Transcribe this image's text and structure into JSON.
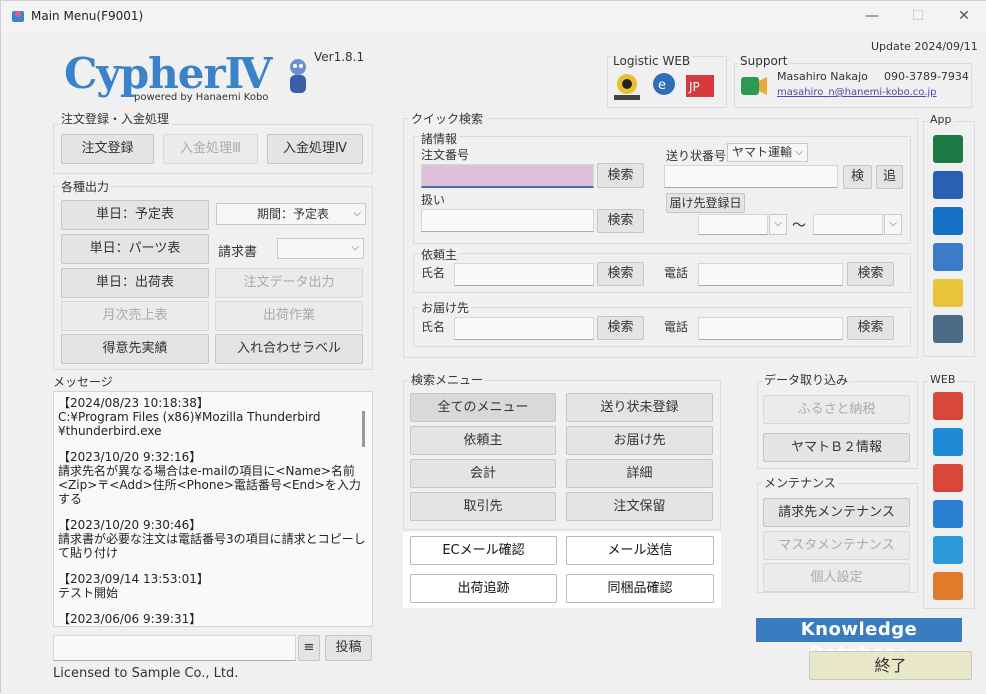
{
  "window": {
    "title": "Main Menu(F9001)",
    "controls": {
      "minimize": "—",
      "maximize": "☐",
      "close": "✕"
    }
  },
  "header": {
    "logo_text": "CypherⅣ",
    "logo_sub": "powered by Hanaemi Kobo",
    "version": "Ver1.8.1",
    "update": "Update 2024/09/11",
    "logistic_title": "Logistic WEB",
    "logistic_icons": [
      "yamato-icon",
      "ecohai-icon",
      "japanpost-icon"
    ],
    "support_title": "Support",
    "support_name": "Masahiro Nakajo",
    "support_phone": "090-3789-7934",
    "support_email": "masahiro_n@hanemi-kobo.co.jp"
  },
  "order_group": {
    "title": "注文登録・入金処理",
    "buttons": [
      "注文登録",
      "入金処理Ⅲ",
      "入金処理Ⅳ"
    ]
  },
  "output_group": {
    "title": "各種出力",
    "btn_daily_schedule": "単日：予定表",
    "select_period": "期間：予定表",
    "btn_daily_parts": "単日：パーツ表",
    "label_invoice": "請求書",
    "btn_daily_shipping": "単日：出荷表",
    "btn_order_export": "注文データ出力",
    "btn_monthly_sales": "月次売上表",
    "btn_shipping_work": "出荷作業",
    "btn_customer_results": "得意先実績",
    "btn_assort_label": "入れ合わせラベル"
  },
  "messages": {
    "title": "メッセージ",
    "entries": [
      "【2024/08/23 10:18:38】\nC:¥Program Files (x86)¥Mozilla Thunderbird\n¥thunderbird.exe",
      "【2023/10/20 9:32:16】\n請求先名が異なる場合はe-mailの項目に<Name>名前<Zip>〒<Add>住所<Phone>電話番号<End>を入力する",
      "【2023/10/20 9:30:46】\n請求書が必要な注文は電話番号3の項目に請求とコピーして貼り付け",
      "【2023/09/14 13:53:01】\nテスト開始",
      "【2023/06/06 9:39:31】"
    ],
    "post_button": "投稿",
    "menu_glyph": "≡",
    "license": "Licensed to Sample Co., Ltd."
  },
  "quick_search": {
    "title": "クイック検索",
    "info_title": "諸情報",
    "order_no_label": "注文番号",
    "tracking_label": "送り状番号",
    "carrier_value": "ヤマト運輸",
    "handling_label": "扱い",
    "delivery_date_button": "届け先登録日",
    "tilde": "～",
    "search": "検索",
    "check": "検",
    "add": "追",
    "requester_title": "依頼主",
    "recipient_title": "お届け先",
    "name_label": "氏名",
    "phone_label": "電話"
  },
  "search_menu": {
    "title": "検索メニュー",
    "buttons": [
      "全てのメニュー",
      "送り状未登録",
      "依頼主",
      "お届け先",
      "会計",
      "詳細",
      "取引先",
      "注文保留"
    ],
    "highlight_buttons": [
      "ECメール確認",
      "メール送信",
      "出荷追跡",
      "同梱品確認"
    ]
  },
  "data_import": {
    "title": "データ取り込み",
    "buttons": [
      "ふるさと納税",
      "ヤマトＢ２情報"
    ]
  },
  "maintenance": {
    "title": "メンテナンス",
    "buttons": [
      "請求先メンテナンス",
      "マスタメンテナンス",
      "個人設定"
    ]
  },
  "app_panel": {
    "title": "App",
    "icons": [
      "excel-icon",
      "word-icon",
      "outlook-icon",
      "notepad-icon",
      "sticky-notes-icon",
      "calculator-icon"
    ],
    "colors": [
      "#1d7a45",
      "#2b5fb4",
      "#1471c4",
      "#3b7bc9",
      "#e8c43a",
      "#4b6a86"
    ]
  },
  "web_panel": {
    "title": "WEB",
    "icons": [
      "chrome-icon",
      "edge-icon",
      "link-icon",
      "mail-icon",
      "browser-icon",
      "do-icon"
    ],
    "colors": [
      "#d9463a",
      "#1e8ad6",
      "#d9463a",
      "#2b7fd1",
      "#2a9ad8",
      "#e07b2c"
    ]
  },
  "footer": {
    "knowledge": "Knowledge Database",
    "exit": "終了"
  }
}
